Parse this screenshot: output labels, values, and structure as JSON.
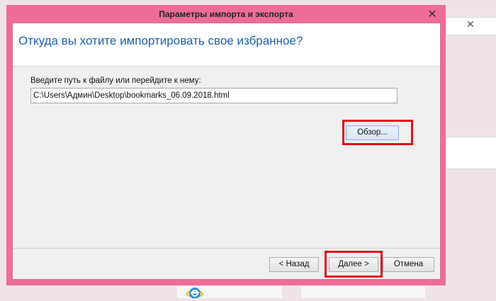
{
  "dialog": {
    "title": "Параметры импорта и экспорта",
    "close_glyph": "✕",
    "heading": "Откуда вы хотите импортировать свое избранное?",
    "path_label": "Введите путь к файлу или перейдите к нему:",
    "path_value": "C:\\Users\\Админ\\Desktop\\bookmarks_06.09.2018.html",
    "browse_label": "Обзор...",
    "back_label": "< Назад",
    "next_label": "Далее >",
    "cancel_label": "Отмена"
  },
  "background": {
    "close_glyph": "✕",
    "icon": "internet-explorer-icon"
  },
  "colors": {
    "window_frame": "#ee6d96",
    "heading": "#1e5fab",
    "highlight": "#e0101a"
  }
}
